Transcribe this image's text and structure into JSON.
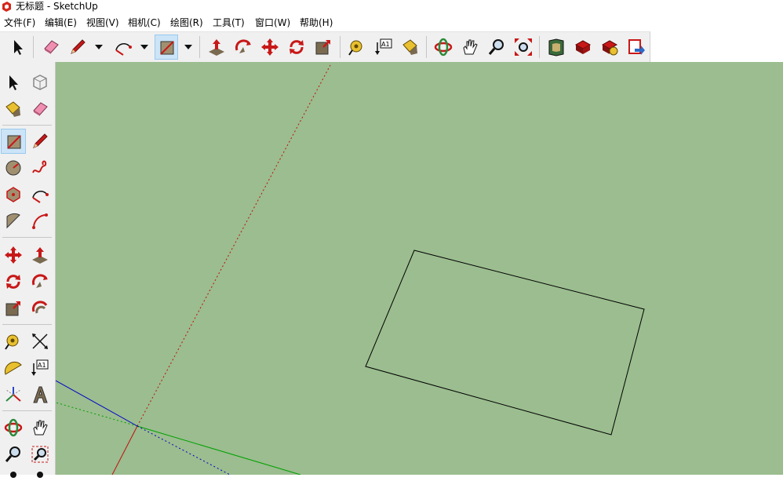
{
  "window": {
    "title": "无标题 - SketchUp",
    "app_icon": "sketchup-logo-icon"
  },
  "menu": [
    {
      "label": "文件(F)"
    },
    {
      "label": "编辑(E)"
    },
    {
      "label": "视图(V)"
    },
    {
      "label": "相机(C)"
    },
    {
      "label": "绘图(R)"
    },
    {
      "label": "工具(T)"
    },
    {
      "label": "窗口(W)"
    },
    {
      "label": "帮助(H)"
    }
  ],
  "toolbar": {
    "tools": [
      "select-icon",
      "eraser-icon",
      "pencil-icon",
      "arc-icon",
      "rectangle-icon",
      "push-pull-icon",
      "follow-me-icon",
      "move-icon",
      "rotate-icon",
      "scale-icon",
      "tape-measure-icon",
      "text-label-icon",
      "paint-bucket-icon",
      "orbit-icon",
      "pan-icon",
      "zoom-icon",
      "zoom-extents-icon",
      "warehouse-icon",
      "share-model-icon",
      "extension-warehouse-icon",
      "send-to-layout-icon"
    ],
    "active_tool": "rectangle-icon",
    "text_tool_glyph": "A1"
  },
  "sidebar": {
    "tools": [
      "select-icon",
      "component-icon",
      "paint-bucket-icon",
      "eraser-icon",
      "rectangle-icon",
      "pencil-icon",
      "circle-icon",
      "freehand-icon",
      "polygon-icon",
      "arc-icon",
      "pie-icon",
      "two-point-arc-icon",
      "move-icon",
      "push-pull-icon",
      "rotate-icon",
      "follow-me-icon",
      "scale-icon",
      "offset-icon",
      "tape-measure-icon",
      "dimension-icon",
      "protractor-icon",
      "text-icon",
      "axes-icon",
      "3d-text-icon",
      "orbit-icon",
      "pan-icon",
      "zoom-icon",
      "zoom-window-icon"
    ],
    "active_tool": "rectangle-icon"
  },
  "colors": {
    "viewport_bg": "#9bbd8f",
    "axis_red": "#c01010",
    "axis_green": "#00a000",
    "axis_blue": "#0000c8",
    "active_button": "#cce4f7",
    "icon_red": "#d0101a"
  }
}
